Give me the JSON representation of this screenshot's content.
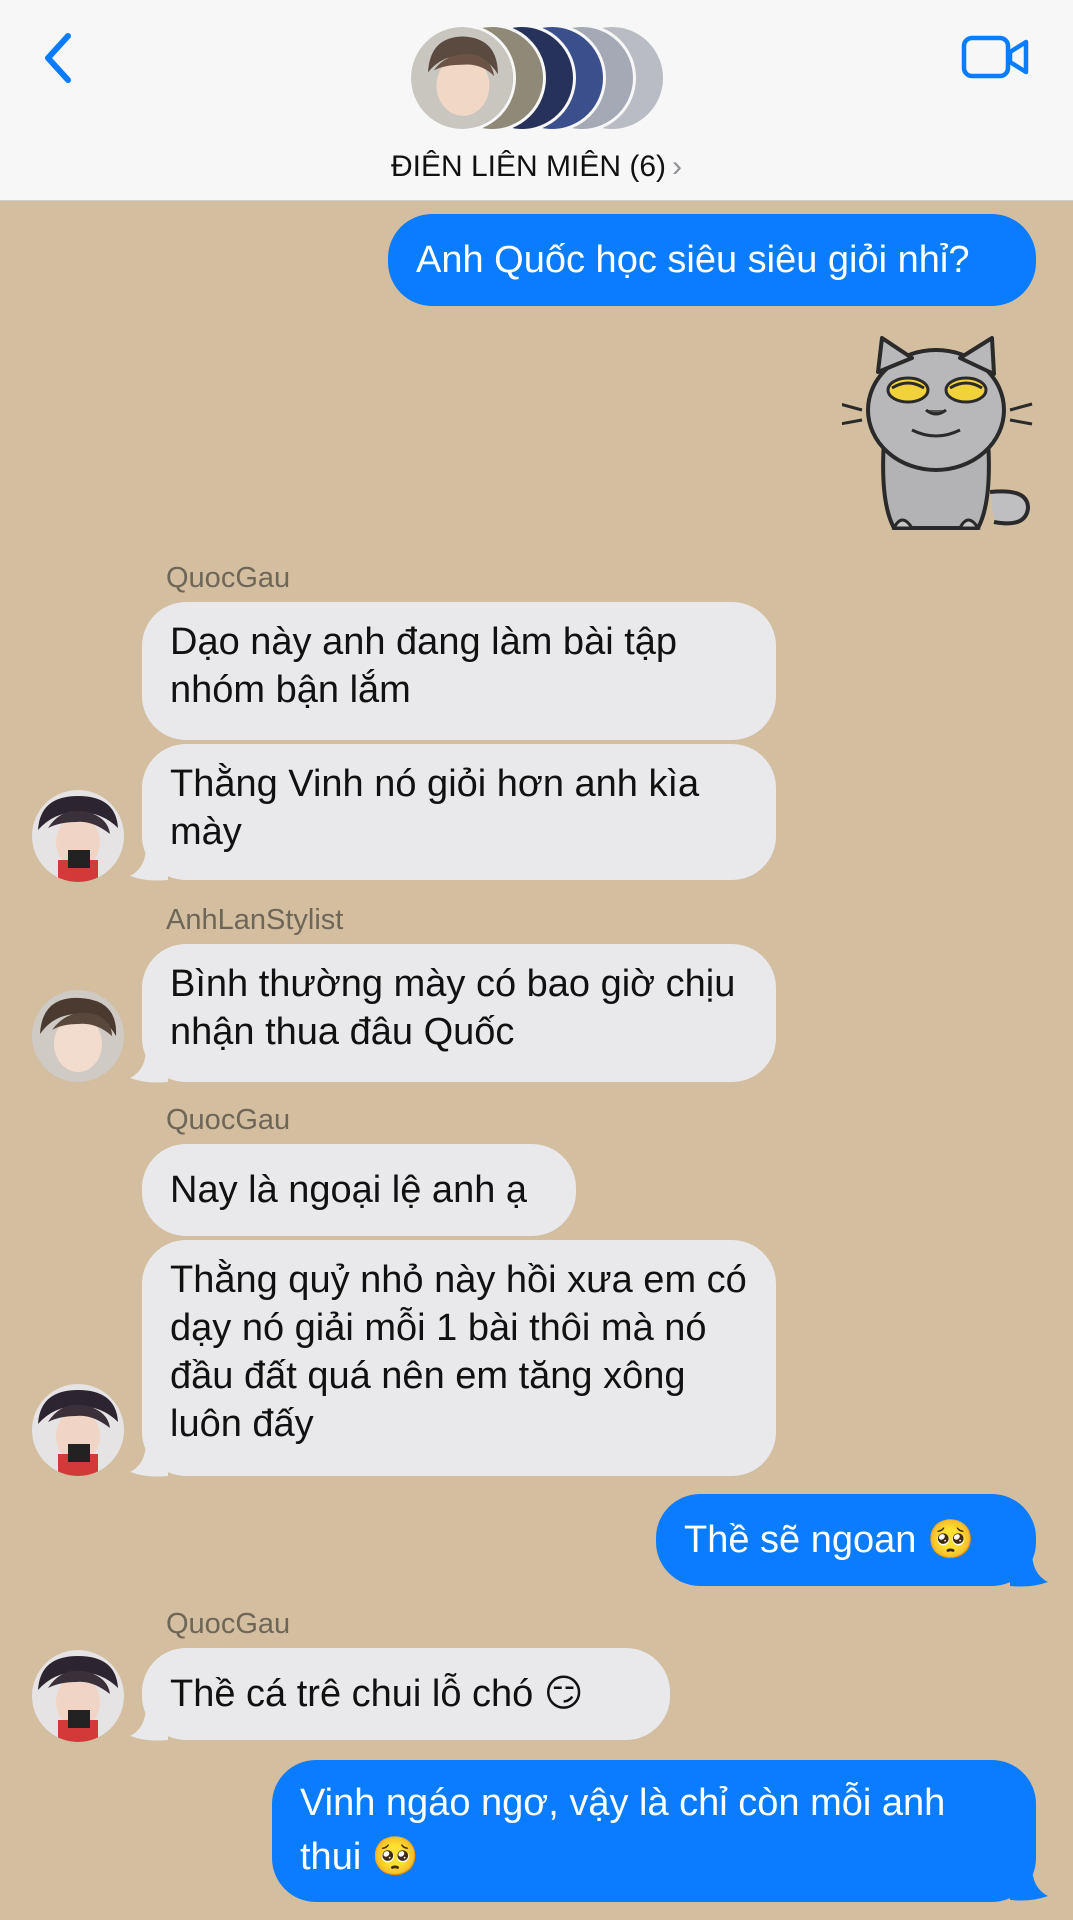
{
  "header": {
    "title": "ĐIÊN LIÊN MIÊN (6)",
    "chevron": "›",
    "back_icon": "chevron-left-icon",
    "video_icon": "video-camera-icon"
  },
  "messages": {
    "m1": "Anh Quốc học siêu siêu giỏi nhỉ?",
    "m2_sender": "QuocGau",
    "m2": "Dạo này anh đang làm bài tập nhóm bận lắm",
    "m3": "Thằng Vinh nó giỏi hơn anh kìa mày",
    "m4_sender": "AnhLanStylist",
    "m4": "Bình thường mày có bao giờ chịu nhận thua đâu Quốc",
    "m5_sender": "QuocGau",
    "m5": "Nay là ngoại lệ anh ạ",
    "m6": "Thằng quỷ nhỏ này hồi xưa em có dạy nó giải mỗi 1 bài thôi mà nó đầu đất quá nên em tăng xông luôn đấy",
    "m7": "Thề sẽ ngoan 🥺",
    "m8_sender": "QuocGau",
    "m8": "Thề cá trê chui lỗ chó 😏",
    "m9": "Vinh ngáo ngơ, vậy là chỉ còn mỗi anh thui 🥺"
  },
  "colors": {
    "outgoing": "#0a7cff",
    "incoming": "#e9e9eb",
    "background": "#d4bea0",
    "accent": "#0a7cff"
  }
}
